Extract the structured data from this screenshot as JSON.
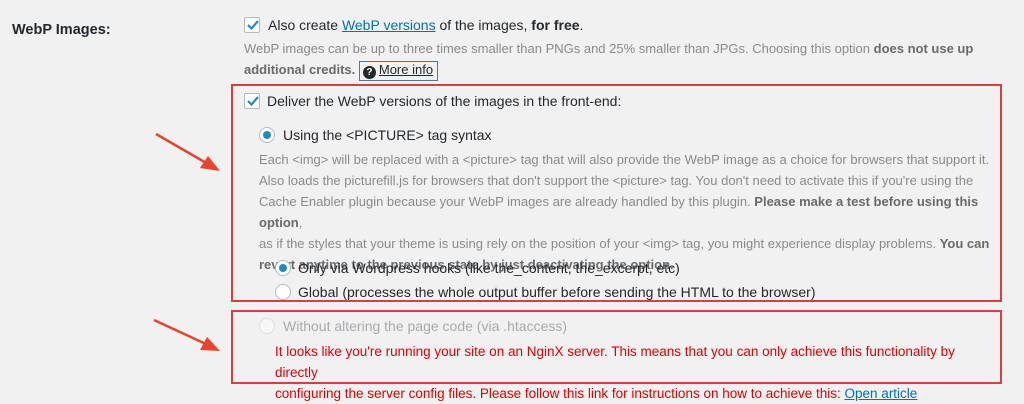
{
  "section": {
    "label": "WebP Images:"
  },
  "webp_create": {
    "prefix": "Also create ",
    "link_text": "WebP versions",
    "suffix": " of the images, ",
    "bold": "for free",
    "end": ".",
    "desc_line1": "WebP images can be up to three times smaller than PNGs and 25% smaller than JPGs. Choosing this option ",
    "desc_bold_1": "does not use up",
    "desc_bold_2": "additional credits.",
    "more_info": "More info",
    "more_info_icon": "question-circle-icon",
    "checked": true
  },
  "deliver": {
    "label": "Deliver the WebP versions of the images in the front-end:",
    "checked": true,
    "picture_option": {
      "label": "Using the <PICTURE> tag syntax",
      "selected": true,
      "desc_l1": "Each <img> will be replaced with a <picture> tag that will also provide the WebP image as a choice for browsers that support it.",
      "desc_l2": "Also loads the picturefill.js for browsers that don't support the <picture> tag. You don't need to activate this if you're using the",
      "desc_l3_plain": "Cache Enabler plugin because your WebP images are already handled by this plugin. ",
      "desc_l3_bold": "Please make a test before using this option",
      "desc_l3_end": ",",
      "desc_l4_plain": "as if the styles that your theme is using rely on the position of your <img> tag, you might experience display problems. ",
      "desc_l4_bold": "You can",
      "desc_l5_bold": "revert anytime to the previous state by just deactivating the option."
    },
    "sub_options": [
      {
        "label": "Only via Wordpress hooks (like the_content, the_excerpt, etc)",
        "selected": true
      },
      {
        "label": "Global (processes the whole output buffer before sending the HTML to the browser)",
        "selected": false
      }
    ]
  },
  "htaccess": {
    "label": "Without altering the page code (via .htaccess)",
    "disabled": true,
    "warning_l1": "It looks like you're running your site on an NginX server. This means that you can only achieve this functionality by directly",
    "warning_l2": "configuring the server config files. Please follow this link for instructions on how to achieve this: ",
    "link_text": "Open article"
  },
  "colors": {
    "highlight": "#e23b3b",
    "accent": "#1e8cbe",
    "link": "#0073aa",
    "warning": "#e00000"
  }
}
